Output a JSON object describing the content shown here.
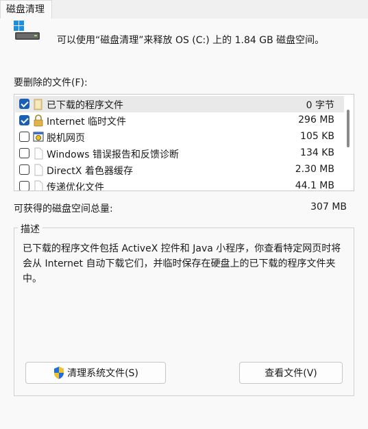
{
  "tab": {
    "label": "磁盘清理"
  },
  "header": {
    "message": "可以使用“磁盘清理”来释放 OS (C:) 上的 1.84 GB 磁盘空间。",
    "icon": "disk-drive-icon"
  },
  "files_label": "要删除的文件(F):",
  "files": [
    {
      "name": "已下载的程序文件",
      "size": "0 字节",
      "checked": true,
      "selected": true,
      "icon": "folder-icon"
    },
    {
      "name": "Internet 临时文件",
      "size": "296 MB",
      "checked": true,
      "selected": false,
      "icon": "lock-icon"
    },
    {
      "name": "脱机网页",
      "size": "105 KB",
      "checked": false,
      "selected": false,
      "icon": "offline-pages-icon"
    },
    {
      "name": "Windows 错误报告和反馈诊断",
      "size": "134 KB",
      "checked": false,
      "selected": false,
      "icon": "file-icon"
    },
    {
      "name": "DirectX 着色器缓存",
      "size": "2.30 MB",
      "checked": false,
      "selected": false,
      "icon": "file-icon"
    },
    {
      "name": "传递优化文件",
      "size": "44.1 MB",
      "checked": false,
      "selected": false,
      "icon": "file-icon"
    }
  ],
  "total": {
    "label": "可获得的磁盘空间总量:",
    "value": "307 MB"
  },
  "description": {
    "legend": "描述",
    "text": "已下载的程序文件包括 ActiveX 控件和 Java 小程序，你查看特定网页时将会从 Internet 自动下载它们，并临时保存在硬盘上的已下载的程序文件夹中。"
  },
  "buttons": {
    "clean_system": "清理系统文件(S)",
    "view_files": "查看文件(V)"
  },
  "colors": {
    "accent": "#1a5fb4",
    "shield_blue": "#1e6fd9",
    "shield_yellow": "#f2c12e"
  }
}
